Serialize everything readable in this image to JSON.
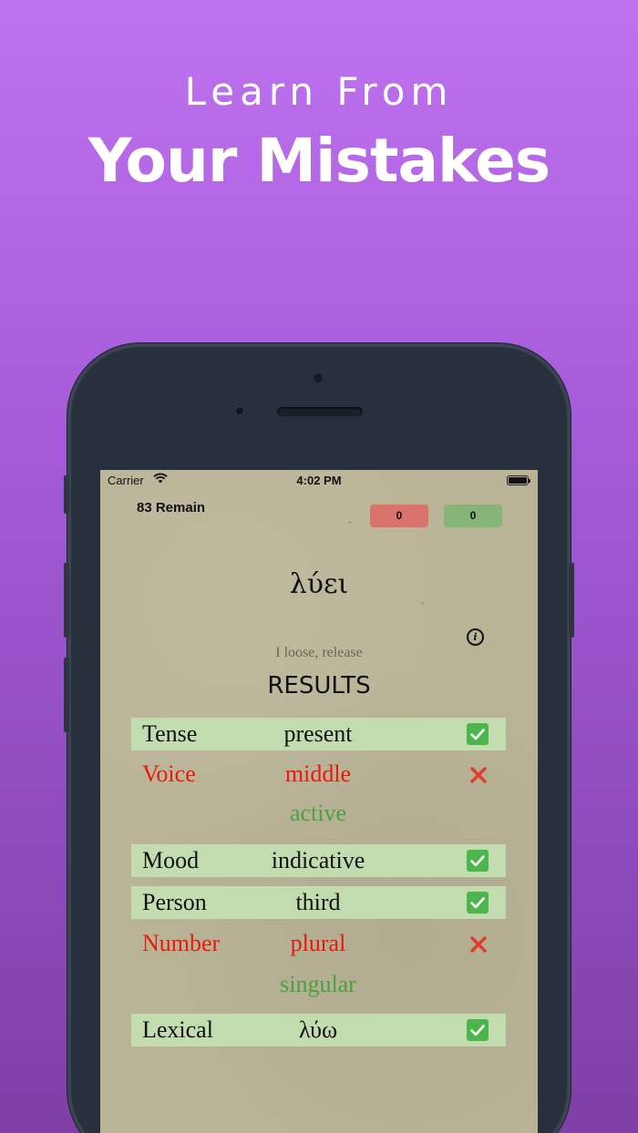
{
  "headline": {
    "line1": "Learn From",
    "line2": "Your Mistakes"
  },
  "status_bar": {
    "carrier": "Carrier",
    "time": "4:02 PM"
  },
  "quiz": {
    "remaining": "83 Remain",
    "wrong_count": "0",
    "right_count": "0",
    "word": "λύει",
    "gloss": "I loose, release",
    "results_title": "RESULTS"
  },
  "results": [
    {
      "label": "Tense",
      "value": "present",
      "status": "correct"
    },
    {
      "label": "Voice",
      "value": "middle",
      "status": "wrong",
      "correction": "active"
    },
    {
      "label": "Mood",
      "value": "indicative",
      "status": "correct"
    },
    {
      "label": "Person",
      "value": "third",
      "status": "correct"
    },
    {
      "label": "Number",
      "value": "plural",
      "status": "wrong",
      "correction": "singular"
    },
    {
      "label": "Lexical",
      "value": "λύω",
      "status": "correct"
    }
  ],
  "colors": {
    "correct_row_bg": "#c4e1b2",
    "wrong_text": "#e8190e",
    "correction_text": "#4aa23c",
    "check_bg": "#4cb54d",
    "wrong_badge": "#d9736c",
    "right_badge": "#86b579"
  },
  "icons": {
    "check": "check-icon",
    "cross": "cross-icon",
    "info": "info-icon",
    "wifi": "wifi-icon",
    "battery": "battery-icon"
  }
}
